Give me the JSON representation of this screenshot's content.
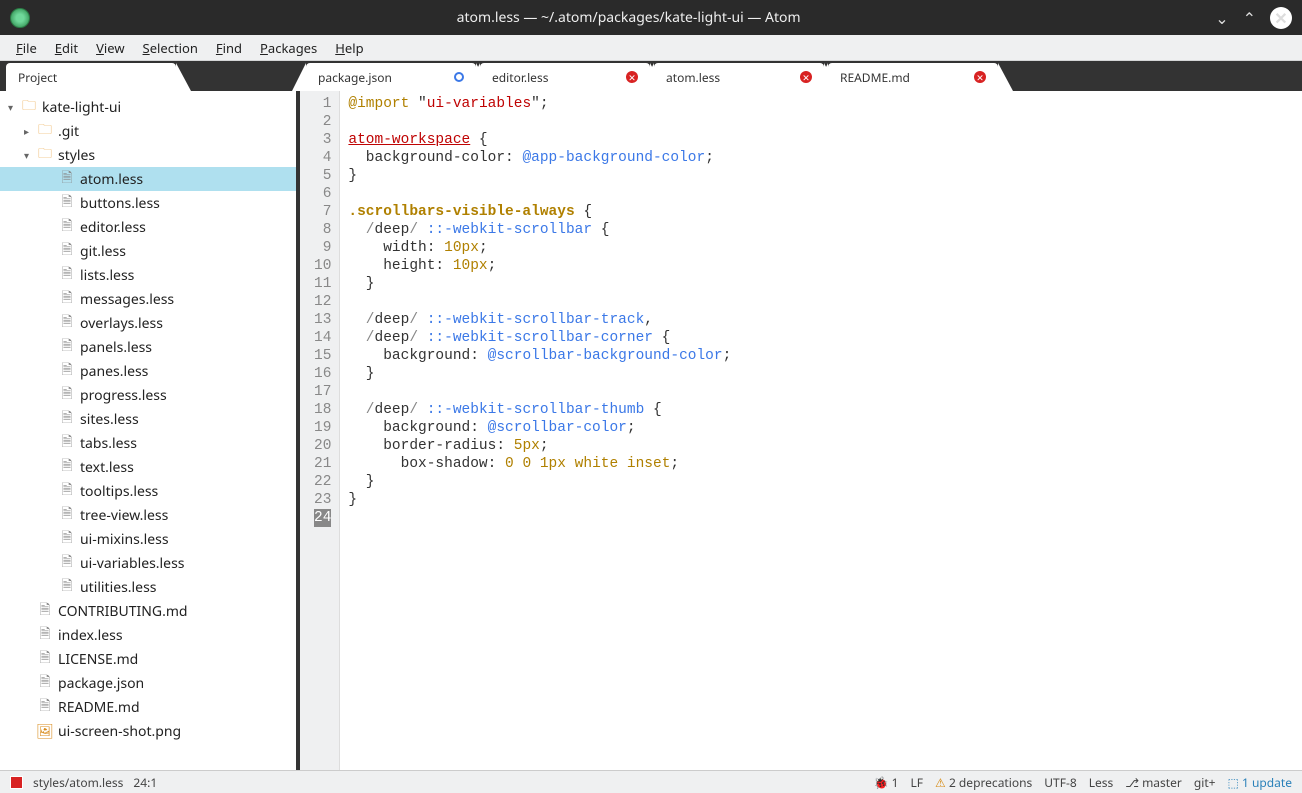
{
  "window": {
    "title": "atom.less — ~/.atom/packages/kate-light-ui — Atom"
  },
  "menu": {
    "items": [
      "File",
      "Edit",
      "View",
      "Selection",
      "Find",
      "Packages",
      "Help"
    ]
  },
  "sidebarTab": {
    "label": "Project"
  },
  "tree": {
    "root": "kate-light-ui",
    "folders": {
      "git": ".git",
      "styles": "styles"
    },
    "stylesFiles": [
      "atom.less",
      "buttons.less",
      "editor.less",
      "git.less",
      "lists.less",
      "messages.less",
      "overlays.less",
      "panels.less",
      "panes.less",
      "progress.less",
      "sites.less",
      "tabs.less",
      "text.less",
      "tooltips.less",
      "tree-view.less",
      "ui-mixins.less",
      "ui-variables.less",
      "utilities.less"
    ],
    "rootFiles": [
      {
        "name": "CONTRIBUTING.md",
        "type": "md"
      },
      {
        "name": "index.less",
        "type": "file"
      },
      {
        "name": "LICENSE.md",
        "type": "md"
      },
      {
        "name": "package.json",
        "type": "file"
      },
      {
        "name": "README.md",
        "type": "md"
      },
      {
        "name": "ui-screen-shot.png",
        "type": "png"
      }
    ]
  },
  "editorTabs": [
    {
      "label": "package.json",
      "close": "blue"
    },
    {
      "label": "editor.less",
      "close": "red"
    },
    {
      "label": "atom.less",
      "close": "red",
      "active": true
    },
    {
      "label": "README.md",
      "close": "red"
    }
  ],
  "code": {
    "lines": [
      {
        "n": 1,
        "tokens": [
          {
            "t": "@import",
            "c": "c-keyword"
          },
          {
            "t": " "
          },
          {
            "t": "\"",
            "c": "c-punct"
          },
          {
            "t": "ui-variables",
            "c": "c-string"
          },
          {
            "t": "\"",
            "c": "c-punct"
          },
          {
            "t": ";"
          }
        ]
      },
      {
        "n": 2,
        "tokens": []
      },
      {
        "n": 3,
        "tokens": [
          {
            "t": "atom-workspace",
            "c": "c-tag"
          },
          {
            "t": " {"
          }
        ]
      },
      {
        "n": 4,
        "tokens": [
          {
            "t": "  background-color",
            "c": "c-prop"
          },
          {
            "t": ": "
          },
          {
            "t": "@app-background-color",
            "c": "c-var"
          },
          {
            "t": ";"
          }
        ]
      },
      {
        "n": 5,
        "tokens": [
          {
            "t": "}"
          }
        ]
      },
      {
        "n": 6,
        "tokens": []
      },
      {
        "n": 7,
        "tokens": [
          {
            "t": ".scrollbars-visible-always",
            "c": "c-class"
          },
          {
            "t": " {"
          }
        ]
      },
      {
        "n": 8,
        "tokens": [
          {
            "t": "  /",
            "c": "c-slash"
          },
          {
            "t": "deep",
            "c": "c-prop"
          },
          {
            "t": "/",
            "c": "c-slash"
          },
          {
            "t": " "
          },
          {
            "t": "::-webkit-scrollbar",
            "c": "c-pseudo"
          },
          {
            "t": " {"
          }
        ]
      },
      {
        "n": 9,
        "tokens": [
          {
            "t": "    width",
            "c": "c-prop"
          },
          {
            "t": ": "
          },
          {
            "t": "10px",
            "c": "c-num"
          },
          {
            "t": ";"
          }
        ]
      },
      {
        "n": 10,
        "tokens": [
          {
            "t": "    height",
            "c": "c-prop"
          },
          {
            "t": ": "
          },
          {
            "t": "10px",
            "c": "c-num"
          },
          {
            "t": ";"
          }
        ]
      },
      {
        "n": 11,
        "tokens": [
          {
            "t": "  }"
          }
        ]
      },
      {
        "n": 12,
        "tokens": []
      },
      {
        "n": 13,
        "tokens": [
          {
            "t": "  /",
            "c": "c-slash"
          },
          {
            "t": "deep",
            "c": "c-prop"
          },
          {
            "t": "/",
            "c": "c-slash"
          },
          {
            "t": " "
          },
          {
            "t": "::-webkit-scrollbar-track",
            "c": "c-pseudo"
          },
          {
            "t": ","
          }
        ]
      },
      {
        "n": 14,
        "tokens": [
          {
            "t": "  /",
            "c": "c-slash"
          },
          {
            "t": "deep",
            "c": "c-prop"
          },
          {
            "t": "/",
            "c": "c-slash"
          },
          {
            "t": " "
          },
          {
            "t": "::-webkit-scrollbar-corner",
            "c": "c-pseudo"
          },
          {
            "t": " {"
          }
        ]
      },
      {
        "n": 15,
        "tokens": [
          {
            "t": "    background",
            "c": "c-prop"
          },
          {
            "t": ": "
          },
          {
            "t": "@scrollbar-background-color",
            "c": "c-var"
          },
          {
            "t": ";"
          }
        ]
      },
      {
        "n": 16,
        "tokens": [
          {
            "t": "  }"
          }
        ]
      },
      {
        "n": 17,
        "tokens": []
      },
      {
        "n": 18,
        "tokens": [
          {
            "t": "  /",
            "c": "c-slash"
          },
          {
            "t": "deep",
            "c": "c-prop"
          },
          {
            "t": "/",
            "c": "c-slash"
          },
          {
            "t": " "
          },
          {
            "t": "::-webkit-scrollbar-thumb",
            "c": "c-pseudo"
          },
          {
            "t": " {"
          }
        ]
      },
      {
        "n": 19,
        "tokens": [
          {
            "t": "    background",
            "c": "c-prop"
          },
          {
            "t": ": "
          },
          {
            "t": "@scrollbar-color",
            "c": "c-var"
          },
          {
            "t": ";"
          }
        ]
      },
      {
        "n": 20,
        "tokens": [
          {
            "t": "    border-radius",
            "c": "c-prop"
          },
          {
            "t": ": "
          },
          {
            "t": "5px",
            "c": "c-num"
          },
          {
            "t": ";"
          }
        ]
      },
      {
        "n": 21,
        "tokens": [
          {
            "t": "      box-shadow",
            "c": "c-prop"
          },
          {
            "t": ": "
          },
          {
            "t": "0 0 1px",
            "c": "c-num"
          },
          {
            "t": " "
          },
          {
            "t": "white",
            "c": "c-const"
          },
          {
            "t": " "
          },
          {
            "t": "inset",
            "c": "c-const"
          },
          {
            "t": ";"
          }
        ]
      },
      {
        "n": 22,
        "tokens": [
          {
            "t": "  }"
          }
        ]
      },
      {
        "n": 23,
        "tokens": [
          {
            "t": "}"
          }
        ]
      },
      {
        "n": 24,
        "tokens": [],
        "active": true
      }
    ]
  },
  "status": {
    "file": "styles/atom.less",
    "cursor": "24:1",
    "bug": "1",
    "lf": "LF",
    "deprecations": "2 deprecations",
    "encoding": "UTF-8",
    "lang": "Less",
    "branch": "master",
    "git": "git+",
    "update": "1 update"
  }
}
